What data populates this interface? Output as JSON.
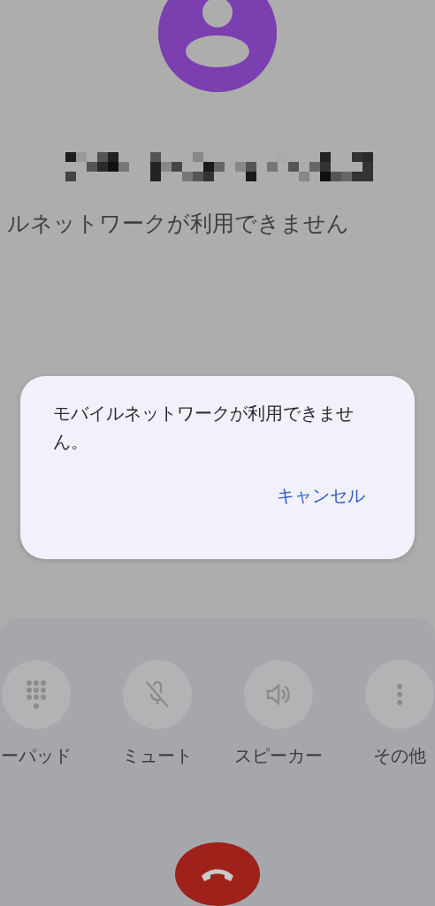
{
  "status": "ルネットワークが利用できません",
  "controls": [
    {
      "kind": "keypad",
      "label": "ーパッド"
    },
    {
      "kind": "mute",
      "label": "ミュート"
    },
    {
      "kind": "speaker",
      "label": "スピーカー"
    },
    {
      "kind": "more",
      "label": "その他"
    }
  ],
  "dialog": {
    "message": "モバイルネットワークが利用できません。",
    "buttons": [
      "キャンセル"
    ]
  }
}
